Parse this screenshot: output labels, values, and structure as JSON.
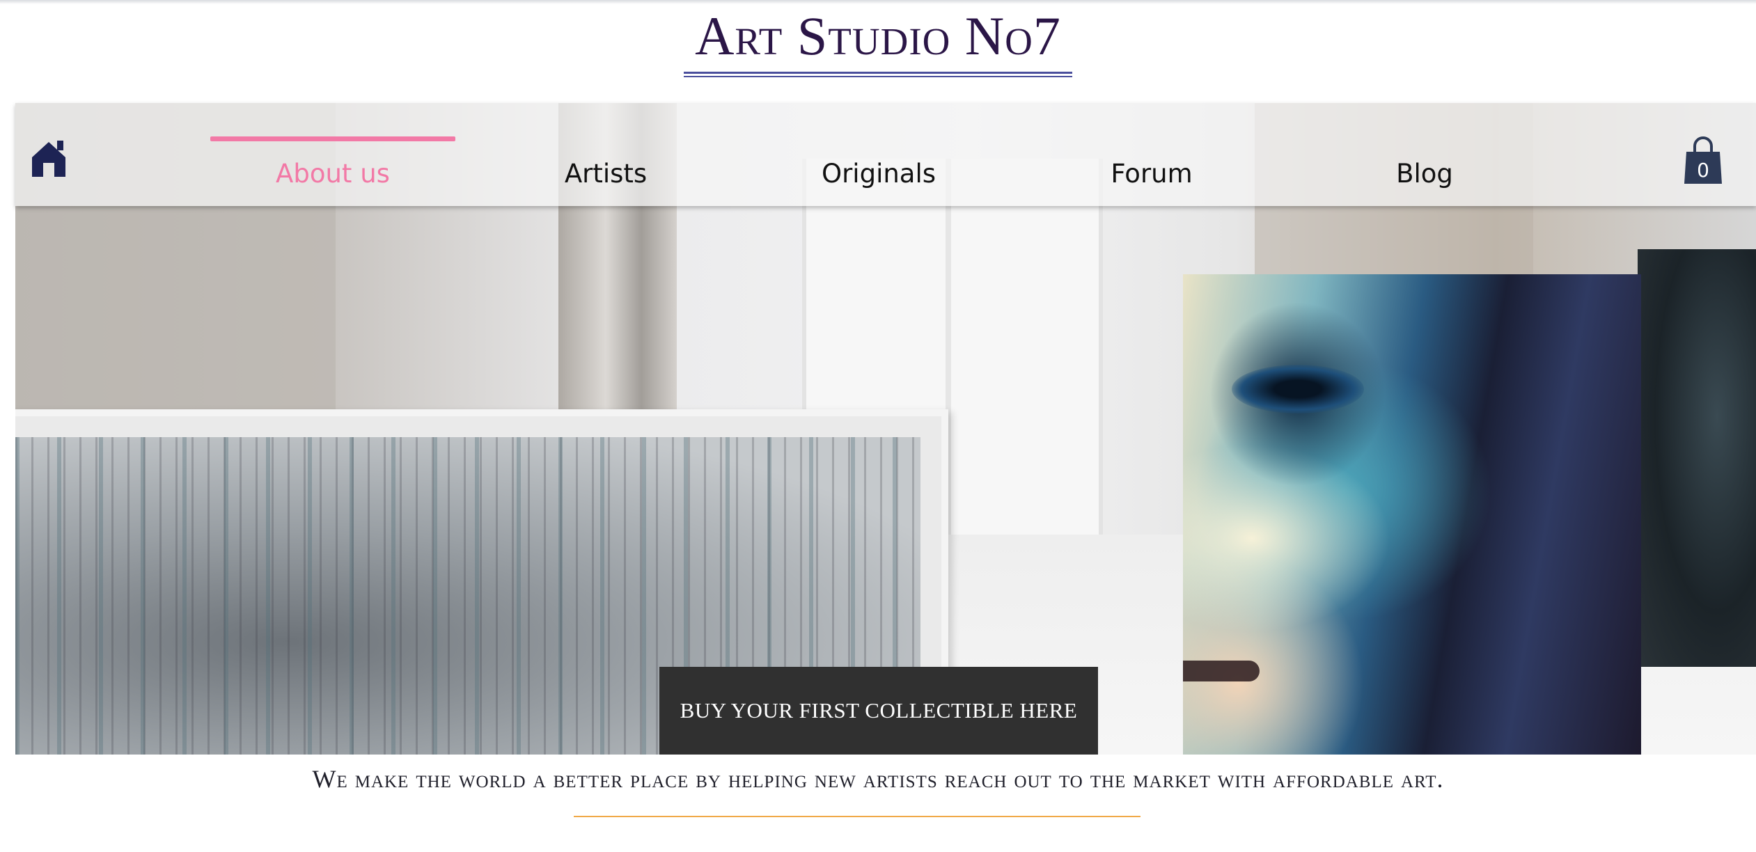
{
  "header": {
    "site_title": "Art Studio No7"
  },
  "nav": {
    "home_icon": "home-icon",
    "items": [
      {
        "label": "About us",
        "active": true
      },
      {
        "label": "Artists",
        "active": false
      },
      {
        "label": "Originals",
        "active": false
      },
      {
        "label": "Forum",
        "active": false
      },
      {
        "label": "Blog",
        "active": false
      }
    ],
    "cart": {
      "icon": "shopping-bag-icon",
      "count": "0"
    }
  },
  "hero": {
    "cta_label": "BUY YOUR FIRST COLLECTIBLE HERE"
  },
  "footer": {
    "tagline": "We make the world a better place by helping new artists reach out to the market  with affordable art."
  },
  "colors": {
    "title": "#2b1647",
    "active_nav": "#f279a6",
    "cta_background": "#303030",
    "cart_icon": "#2d3a57",
    "tagline_rule": "#f0a948"
  }
}
